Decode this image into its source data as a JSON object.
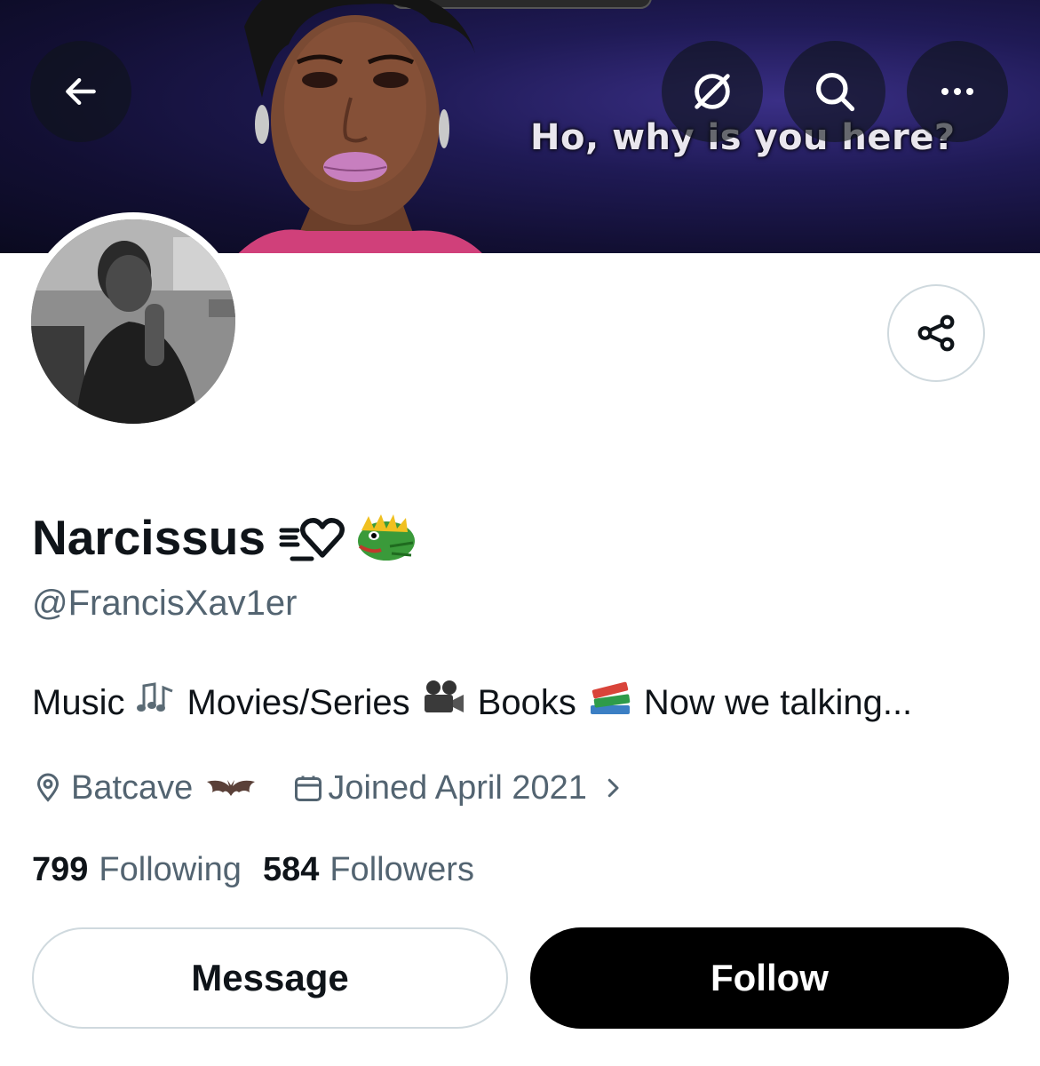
{
  "banner": {
    "caption": "Ho, why is you here?"
  },
  "header": {
    "back_icon": "arrow-left-icon",
    "actions": [
      "grok-icon",
      "search-icon",
      "more-icon"
    ]
  },
  "profile": {
    "display_name": "Narcissus",
    "handle": "@FrancisXav1er",
    "bio_parts": [
      "Music",
      "Movies/Series",
      "Books",
      "Now we talking..."
    ],
    "location": "Batcave",
    "joined": "Joined April 2021",
    "following_count": "799",
    "following_label": "Following",
    "followers_count": "584",
    "followers_label": "Followers"
  },
  "actions": {
    "message_label": "Message",
    "follow_label": "Follow"
  },
  "colors": {
    "text_primary": "#0f1419",
    "text_secondary": "#536471",
    "border": "#cfd9de",
    "follow_bg": "#000000"
  }
}
